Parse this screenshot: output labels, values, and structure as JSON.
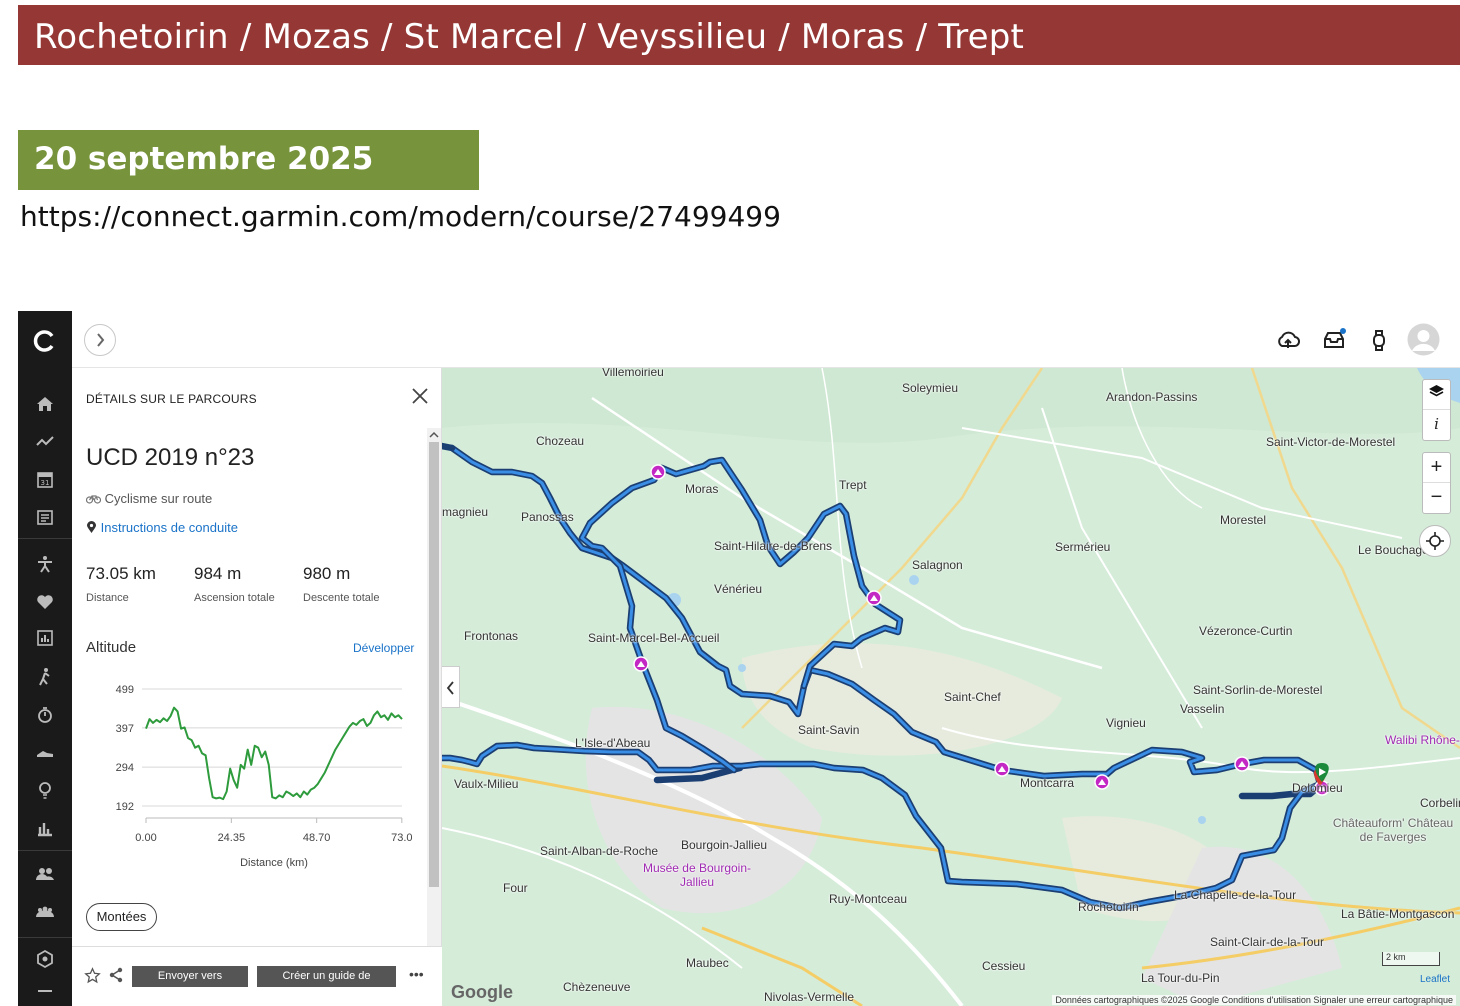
{
  "slide": {
    "title": "Rochetoirin / Mozas / St Marcel / Veyssilieu / Moras / Trept",
    "date": "20 septembre 2025",
    "url": "https://connect.garmin.com/modern/course/27499499"
  },
  "panel": {
    "header": "DÉTAILS SUR LE PARCOURS",
    "course_name": "UCD 2019 n°23",
    "sport": "Cyclisme sur route",
    "instructions_link": "Instructions de conduite",
    "stats": [
      {
        "value": "73.05 km",
        "label": "Distance"
      },
      {
        "value": "984 m",
        "label": "Ascension totale"
      },
      {
        "value": "980 m",
        "label": "Descente totale"
      }
    ],
    "altitude_title": "Altitude",
    "develop_link": "Développer",
    "montees_button": "Montées",
    "footer": {
      "send_to": "Envoyer vers",
      "create_guide": "Créer un guide de",
      "more": "•••"
    }
  },
  "chart_data": {
    "type": "line",
    "xlabel": "Distance (km)",
    "ylabel": "",
    "x_ticks": [
      "0.00",
      "24.35",
      "48.70",
      "73.0"
    ],
    "y_ticks": [
      "499",
      "397",
      "294",
      "192"
    ],
    "xlim": [
      0,
      73.05
    ],
    "ylim": [
      192,
      499
    ],
    "line_color": "#2e9b3c",
    "x": [
      0,
      1,
      2,
      3,
      4,
      5,
      6,
      7,
      8,
      9,
      10,
      11,
      12,
      13,
      14,
      15,
      16,
      17,
      18,
      19,
      20,
      21,
      22,
      23,
      24,
      25,
      26,
      27,
      28,
      29,
      30,
      31,
      32,
      33,
      34,
      35,
      36,
      37,
      38,
      39,
      40,
      41,
      42,
      43,
      44,
      45,
      46,
      47,
      48,
      49,
      50,
      51,
      52,
      53,
      54,
      55,
      56,
      57,
      58,
      59,
      60,
      61,
      62,
      63,
      64,
      65,
      66,
      67,
      68,
      69,
      70,
      71,
      72,
      73
    ],
    "values": [
      395,
      420,
      410,
      418,
      412,
      422,
      415,
      428,
      450,
      440,
      395,
      398,
      370,
      365,
      345,
      350,
      330,
      325,
      265,
      215,
      212,
      214,
      210,
      230,
      290,
      260,
      240,
      300,
      290,
      340,
      300,
      350,
      345,
      320,
      335,
      300,
      215,
      212,
      220,
      215,
      230,
      225,
      218,
      225,
      215,
      230,
      222,
      235,
      240,
      250,
      265,
      280,
      300,
      320,
      340,
      355,
      370,
      385,
      400,
      410,
      405,
      415,
      420,
      402,
      410,
      430,
      440,
      425,
      430,
      418,
      435,
      425,
      430,
      420
    ]
  },
  "map": {
    "labels": [
      {
        "text": "Villemoirieu"
      },
      {
        "text": "Soleymieu"
      },
      {
        "text": "Arandon-Passins"
      },
      {
        "text": "Chozeau"
      },
      {
        "text": "Moras"
      },
      {
        "text": "Trept"
      },
      {
        "text": "Saint-Victor-de-Morestel"
      },
      {
        "text": "Panossas"
      },
      {
        "text": "Morestel"
      },
      {
        "text": "Saint-Hilaire-de-Brens"
      },
      {
        "text": "Sermérieu"
      },
      {
        "text": "Le Bouchage"
      },
      {
        "text": "Salagnon"
      },
      {
        "text": "Vénérieu"
      },
      {
        "text": "Frontonas"
      },
      {
        "text": "Saint-Marcel-Bel-Accueil"
      },
      {
        "text": "Vézeronce-Curtin"
      },
      {
        "text": "Saint-Chef"
      },
      {
        "text": "Saint-Sorlin-de-Morestel"
      },
      {
        "text": "Vasselin"
      },
      {
        "text": "Vignieu"
      },
      {
        "text": "Saint-Savin"
      },
      {
        "text": "L'Isle-d'Abeau"
      },
      {
        "text": "Vaulx-Milieu"
      },
      {
        "text": "Montcarra"
      },
      {
        "text": "Dolomieu"
      },
      {
        "text": "Corbelin"
      },
      {
        "text": "Bourgoin-Jallieu"
      },
      {
        "text": "Saint-Alban-de-Roche"
      },
      {
        "text": "Musée de Bourgoin-Jallieu"
      },
      {
        "text": "Four"
      },
      {
        "text": "Ruy-Montceau"
      },
      {
        "text": "Rochetoirin"
      },
      {
        "text": "La Chapelle-de-la-Tour"
      },
      {
        "text": "La Bâtie-Montgascon"
      },
      {
        "text": "Saint-Clair-de-la-Tour"
      },
      {
        "text": "Maubec"
      },
      {
        "text": "Cessieu"
      },
      {
        "text": "La Tour-du-Pin"
      },
      {
        "text": "Chèzeneuve"
      },
      {
        "text": "Nivolas-Vermelle"
      },
      {
        "text": "Walibi Rhône-"
      },
      {
        "text": "Châteauform' Château de Faverges"
      },
      {
        "text": "magnieu"
      }
    ],
    "scale": "2 km",
    "google": "Google",
    "leaflet": "Leaflet",
    "attribution": "Données cartographiques ©2025 Google   Conditions d'utilisation   Signaler une erreur cartographique"
  }
}
